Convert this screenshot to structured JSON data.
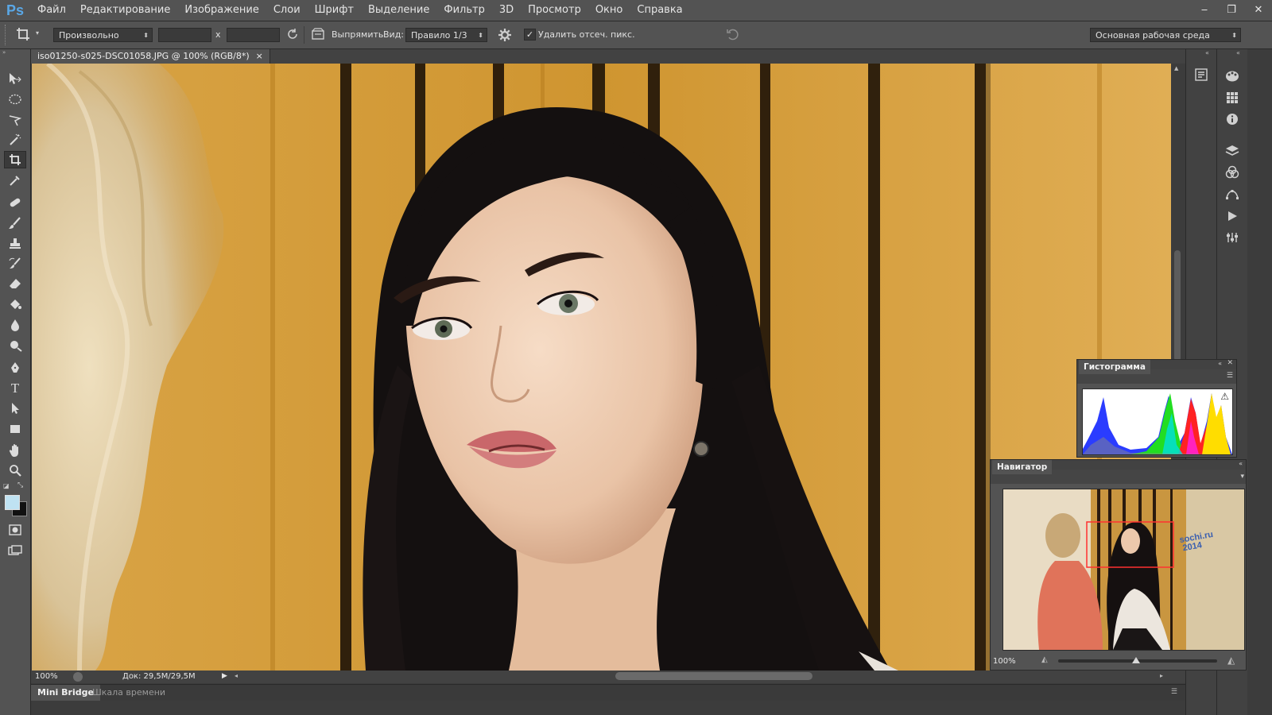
{
  "app": {
    "logo": "Ps"
  },
  "menu": [
    "Файл",
    "Редактирование",
    "Изображение",
    "Слои",
    "Шрифт",
    "Выделение",
    "Фильтр",
    "3D",
    "Просмотр",
    "Окно",
    "Справка"
  ],
  "window_controls": {
    "minimize": "‒",
    "restore": "❐",
    "close": "✕"
  },
  "options": {
    "ratio_select": "Произвольно",
    "x_label": "x",
    "straighten_label": "Выпрямить",
    "view_label": "Вид:",
    "view_select": "Правило 1/3",
    "delete_cropped_label": "Удалить отсеч. пикс.",
    "delete_cropped_checked": true,
    "workspace_select": "Основная рабочая среда"
  },
  "document": {
    "tab_title": "iso01250-s025-DSC01058.JPG @ 100% (RGB/8*)",
    "close_glyph": "×"
  },
  "status": {
    "zoom": "100%",
    "doc_info": "Док: 29,5M/29,5M"
  },
  "bottom_tabs": [
    "Mini Bridge",
    "Шкала времени"
  ],
  "histogram": {
    "title": "Гистограмма",
    "warning_glyph": "⚠"
  },
  "navigator": {
    "title": "Навигатор",
    "zoom": "100%",
    "zoom_slider_fraction": 0.49,
    "thumb_text": "sochi.ru\n2014"
  },
  "colors": {
    "foreground": "#bfe2f2",
    "background": "#111111",
    "accent": "#5aa7e6",
    "navigator_box": "#ff3030"
  }
}
